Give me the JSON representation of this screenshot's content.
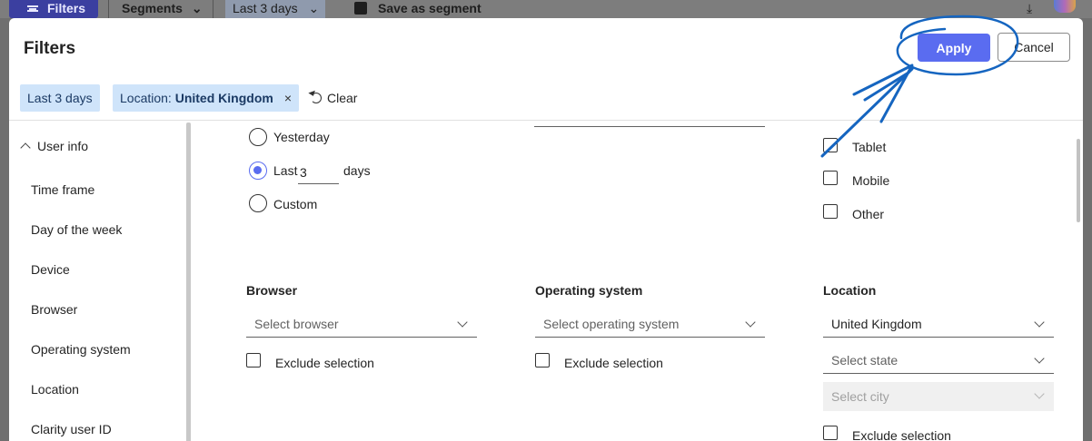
{
  "background_toolbar": {
    "filters_label": "Filters",
    "segments_label": "Segments",
    "last3_label": "Last 3 days",
    "save_label": "Save as segment",
    "download_glyph": "⤓",
    "chevron_glyph": "⌄"
  },
  "panel": {
    "title": "Filters",
    "apply_label": "Apply",
    "cancel_label": "Cancel"
  },
  "chips": {
    "last3": "Last 3 days",
    "location_prefix": "Location:",
    "location_value": "United Kingdom",
    "remove_glyph": "×",
    "clear_label": "Clear"
  },
  "nav": {
    "section": "User info",
    "items": [
      "Time frame",
      "Day of the week",
      "Device",
      "Browser",
      "Operating system",
      "Location",
      "Clarity user ID"
    ]
  },
  "timeframe": {
    "yesterday": "Yesterday",
    "last": "Last",
    "days_value": "3",
    "days": "days",
    "custom": "Custom"
  },
  "device": {
    "tablet": "Tablet",
    "mobile": "Mobile",
    "other": "Other"
  },
  "browser": {
    "label": "Browser",
    "placeholder": "Select browser",
    "exclude": "Exclude selection"
  },
  "os": {
    "label": "Operating system",
    "placeholder": "Select operating system",
    "exclude": "Exclude selection"
  },
  "location": {
    "label": "Location",
    "country": "United Kingdom",
    "state_placeholder": "Select state",
    "city_placeholder": "Select city",
    "exclude": "Exclude selection"
  },
  "colors": {
    "accent": "#5a6cf0",
    "chip_bg": "#cfe4fa",
    "annotation": "#1565c0"
  }
}
